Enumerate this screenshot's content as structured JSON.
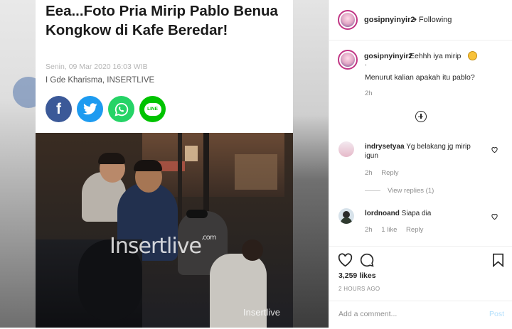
{
  "article": {
    "headline": "Eea...Foto Pria Mirip Pablo Benua Kongkow di Kafe Beredar!",
    "date": "Senin, 09 Mar 2020 16:03 WIB",
    "author": "I Gde Kharisma, INSERTLIVE",
    "share_buttons": [
      {
        "icon": "facebook-icon",
        "label": "f"
      },
      {
        "icon": "twitter-icon",
        "label": ""
      },
      {
        "icon": "whatsapp-icon",
        "label": ""
      },
      {
        "icon": "line-icon",
        "label": "LINE"
      }
    ],
    "watermark_large": "Insertlive",
    "watermark_site": ".com",
    "watermark_small": "Insertlive"
  },
  "post": {
    "username": "gosipnyinyir2",
    "separator": "•",
    "follow_status": "Following",
    "caption": {
      "username": "gosipnyinyir2",
      "line1": "Eehhh iya mirip",
      "line_dot": ".",
      "line2": "Menurut kalian apakah itu pablo?",
      "time": "2h"
    },
    "comments": [
      {
        "username": "indrysetyaa",
        "text": "Yg belakang jg mirip",
        "text2": "igun",
        "time": "2h",
        "reply": "Reply",
        "view_replies": "View replies (1)"
      },
      {
        "username": "lordnoand",
        "text": "Siapa dia",
        "time": "2h",
        "likes": "1 like",
        "reply": "Reply"
      }
    ],
    "likes": "3,259 likes",
    "posted_ago": "2 HOURS AGO",
    "comment_placeholder": "Add a comment...",
    "post_button": "Post"
  },
  "colors": {
    "facebook": "#3b5998",
    "twitter": "#1d9bf0",
    "whatsapp": "#25d366",
    "line": "#00c300",
    "post_disabled": "#b2dffc"
  }
}
